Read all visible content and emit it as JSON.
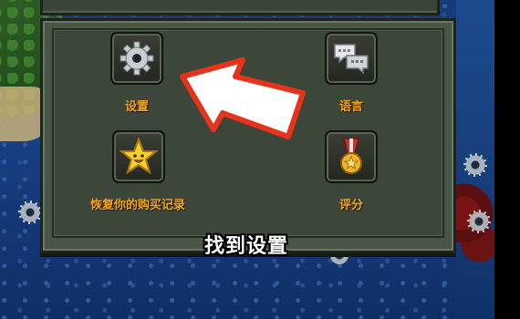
{
  "menu": {
    "settings": {
      "label": "设置",
      "icon": "gear-icon"
    },
    "language": {
      "label": "语言",
      "icon": "speech-bubbles-icon"
    },
    "restore_purchases": {
      "label": "恢复你的购买记录",
      "icon": "star-icon"
    },
    "rate": {
      "label": "评分",
      "icon": "medal-icon"
    }
  },
  "caption": "找到设置",
  "colors": {
    "label": "#f3a322",
    "arrow_fill": "#ffffff",
    "arrow_outline": "#e8331b",
    "panel": "#4a5645"
  }
}
